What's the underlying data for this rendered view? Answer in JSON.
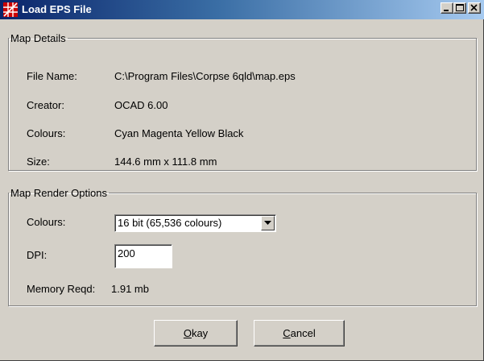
{
  "window": {
    "title": "Load EPS File"
  },
  "map_details": {
    "legend": "Map Details",
    "file_name_label": "File Name:",
    "file_name_value": "C:\\Program Files\\Corpse 6qld\\map.eps",
    "creator_label": "Creator:",
    "creator_value": "OCAD 6.00",
    "colours_label": "Colours:",
    "colours_value": "Cyan Magenta Yellow Black",
    "size_label": "Size:",
    "size_value": "144.6 mm x 111.8 mm"
  },
  "render_options": {
    "legend": "Map Render Options",
    "colours_label": "Colours:",
    "colours_selected": "16 bit (65,536 colours)",
    "dpi_label": "DPI:",
    "dpi_value": "200",
    "memory_label": "Memory Reqd:",
    "memory_value": "1.91 mb"
  },
  "buttons": {
    "okay_mnemonic": "O",
    "okay_rest": "kay",
    "cancel_mnemonic": "C",
    "cancel_rest": "ancel"
  },
  "colors": {
    "title_start": "#0a246a",
    "title_end": "#a6caf0",
    "face": "#d4d0c8",
    "icon_red": "#cc0000"
  },
  "icons": {
    "app": "red-grid-app-icon",
    "minimize": "minimize-icon",
    "maximize": "maximize-icon",
    "close": "close-icon",
    "dropdown": "chevron-down-icon"
  }
}
